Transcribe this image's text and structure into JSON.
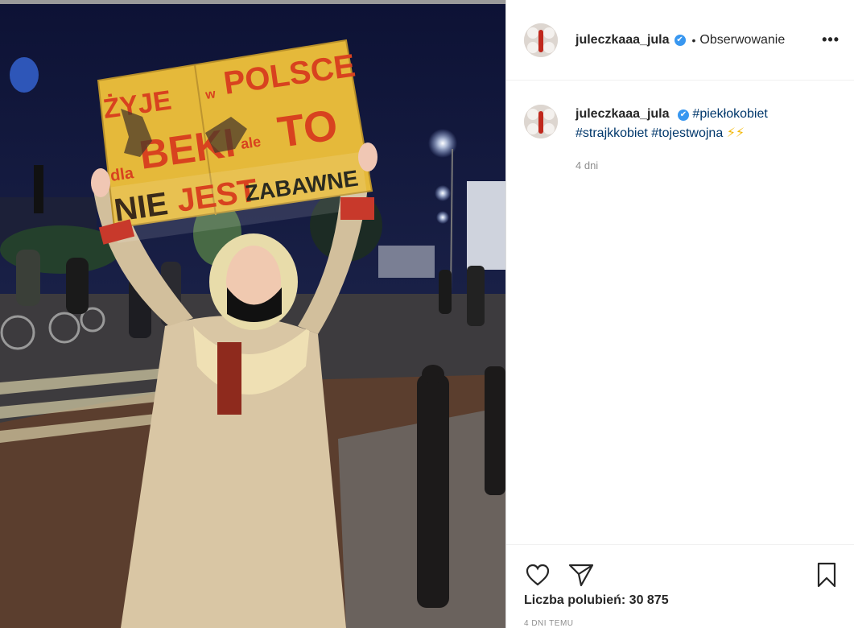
{
  "window": {
    "top_strip_text": ""
  },
  "post": {
    "image": {
      "sign_line1_a": "ŻYJE",
      "sign_line1_b": "w",
      "sign_line1_c": "POLSCE",
      "sign_line2_a": "dla",
      "sign_line2_b": "BEKI",
      "sign_line2_c": "ale",
      "sign_line2_d": "TO",
      "sign_line3_a": "NIE",
      "sign_line3_b": "JEST",
      "sign_line3_c": "ZABAWNE"
    },
    "header": {
      "username": "juleczkaaa_jula",
      "verified_glyph": "✔",
      "dot": "•",
      "follow_state": "Obserwowanie",
      "more_glyph": "•••"
    },
    "caption": {
      "username": "juleczkaaa_jula",
      "verified_glyph": "✔",
      "tag1": "#piekłokobiet",
      "tag2": "#strajkkobiet",
      "tag3": "#tojestwojna",
      "emoji": "⚡⚡",
      "time": "4 dni"
    },
    "actions": {
      "like_icon": "heart-icon",
      "share_icon": "paper-plane-icon",
      "bookmark_icon": "bookmark-icon",
      "likes_text": "Liczba polubień: 30 875",
      "post_date": "4 DNI TEMU"
    }
  },
  "colors": {
    "link": "#00376b",
    "verified": "#3897f0",
    "sign": "#e5b93a",
    "sign_text": "#d8421f"
  }
}
